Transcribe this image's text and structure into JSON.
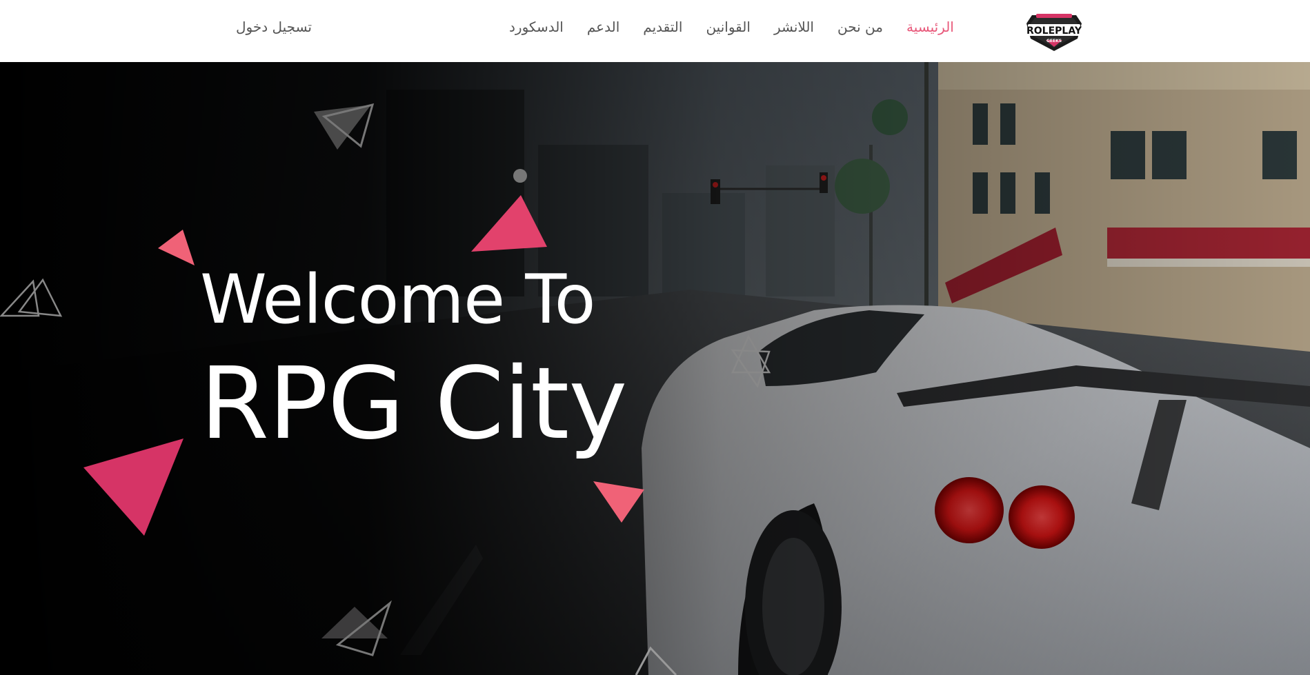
{
  "nav": {
    "login": "تسجيل دخول",
    "links": [
      {
        "label": "الرئيسية",
        "active": true
      },
      {
        "label": "من نحن",
        "active": false
      },
      {
        "label": "اللانشر",
        "active": false
      },
      {
        "label": "القوانين",
        "active": false
      },
      {
        "label": "التقديم",
        "active": false
      },
      {
        "label": "الدعم",
        "active": false
      },
      {
        "label": "الدسكورد",
        "active": false
      }
    ],
    "logo": {
      "line1": "ROLEPLAY",
      "line2": "GEEKS"
    }
  },
  "hero": {
    "welcome": "Welcome To",
    "title": "RPG City"
  },
  "colors": {
    "accent": "#e8587a",
    "accent_dark": "#d63466",
    "nav_bg": "#ffffff",
    "nav_text": "#555555"
  }
}
